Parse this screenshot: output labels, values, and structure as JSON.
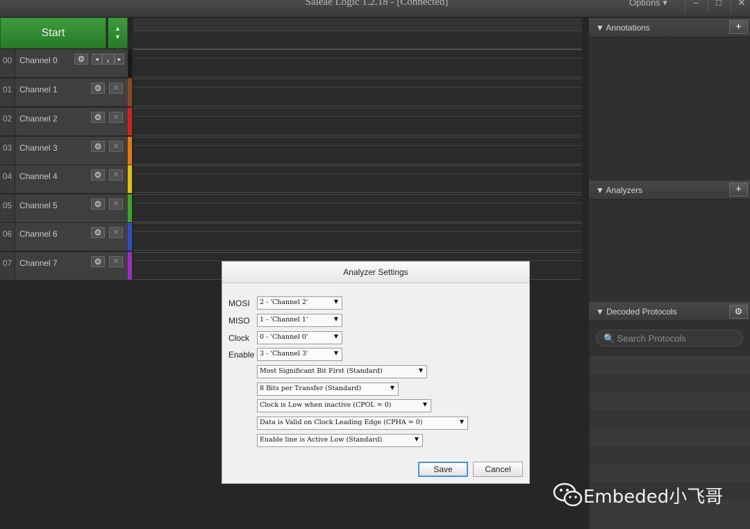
{
  "window": {
    "title": "Saleae Logic 1.2.18 - [Connected]",
    "options_label": "Options ▾",
    "minimize": "–",
    "maximize": "□",
    "close": "✕"
  },
  "toolbar": {
    "start_label": "Start",
    "arrows": "▲\n▼"
  },
  "channels": [
    {
      "num": "00",
      "name": "Channel 0",
      "color": "#1a1a1a"
    },
    {
      "num": "01",
      "name": "Channel 1",
      "color": "#8a4b22"
    },
    {
      "num": "02",
      "name": "Channel 2",
      "color": "#d32020"
    },
    {
      "num": "03",
      "name": "Channel 3",
      "color": "#e07a10"
    },
    {
      "num": "04",
      "name": "Channel 4",
      "color": "#e0c010"
    },
    {
      "num": "05",
      "name": "Channel 5",
      "color": "#3fa32b"
    },
    {
      "num": "06",
      "name": "Channel 6",
      "color": "#2d4fb8"
    },
    {
      "num": "07",
      "name": "Channel 7",
      "color": "#9b2fc0"
    }
  ],
  "channel_icons": {
    "gear": "⚙",
    "close": "✕",
    "prev": "◂",
    "trigger": "⸤",
    "next": "▸",
    "grip": "::::"
  },
  "right_panel": {
    "annotations_title": "▼ Annotations",
    "analyzers_title": "▼ Analyzers",
    "decoded_title": "▼ Decoded Protocols",
    "add": "+",
    "search_placeholder": "🔍 Search Protocols"
  },
  "dialog": {
    "title": "Analyzer Settings",
    "fields": [
      {
        "label": "MOSI",
        "value": "2 - 'Channel 2'"
      },
      {
        "label": "MISO",
        "value": "1 - 'Channel 1'"
      },
      {
        "label": "Clock",
        "value": "0 - 'Channel 0'"
      },
      {
        "label": "Enable",
        "value": "3 - 'Channel 3'"
      }
    ],
    "options": [
      "Most Significant Bit First (Standard)",
      "8 Bits per Transfer (Standard)",
      "Clock is Low when inactive (CPOL = 0)",
      "Data is Valid on Clock Leading Edge (CPHA = 0)",
      "Enable line is Active Low (Standard)"
    ],
    "save_label": "Save",
    "cancel_label": "Cancel"
  },
  "watermark": "Embeded小飞哥"
}
